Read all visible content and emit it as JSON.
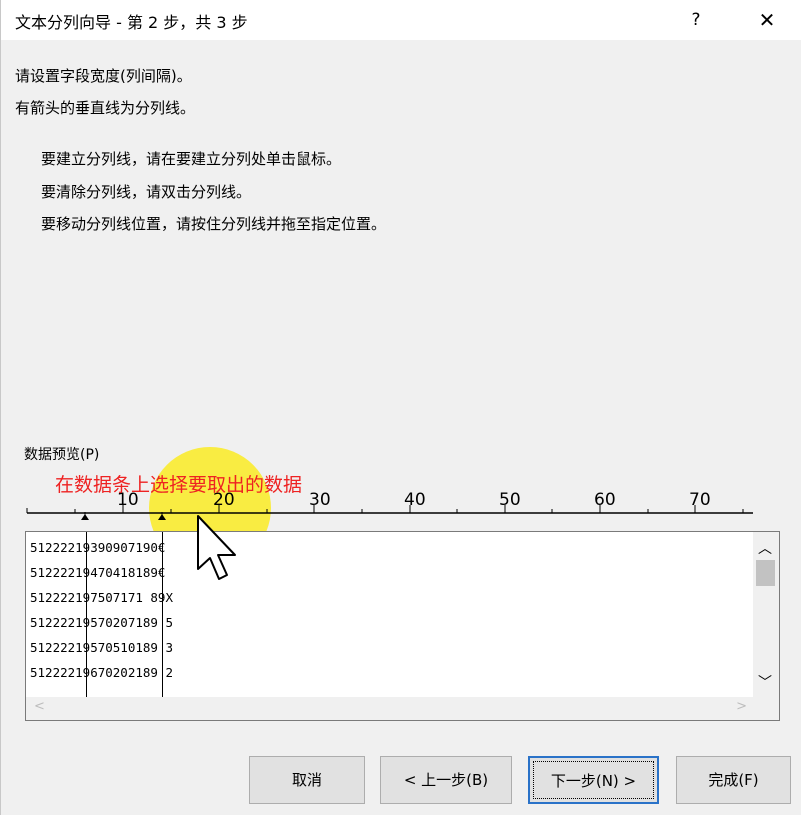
{
  "dialog": {
    "title": "文本分列向导 - 第 2 步，共 3 步",
    "help_glyph": "?",
    "close_glyph": "✕"
  },
  "instructions": {
    "line1": "请设置字段宽度(列间隔)。",
    "line2": "有箭头的垂直线为分列线。",
    "bullet1": "要建立分列线，请在要建立分列处单击鼠标。",
    "bullet2": "要清除分列线，请双击分列线。",
    "bullet3": "要移动分列线位置，请按住分列线并拖至指定位置。"
  },
  "preview": {
    "label": "数据预览(P)",
    "annotation": "在数据条上选择要取出的数据",
    "ruler_numbers": [
      "10",
      "20",
      "30",
      "40",
      "50",
      "60",
      "70"
    ],
    "rows": [
      "51222219390907190€",
      "51222219470418189€",
      "512222197507171 89X",
      "51222219570207189 5",
      "51222219570510189 3",
      "51222219670202189 2"
    ]
  },
  "buttons": {
    "cancel": "取消",
    "back": "< 上一步(B)",
    "next": "下一步(N) >",
    "finish": "完成(F)"
  },
  "colors": {
    "annotation_red": "#ee2222",
    "highlight_yellow": "#faeb23",
    "primary_border": "#2a72c8"
  }
}
